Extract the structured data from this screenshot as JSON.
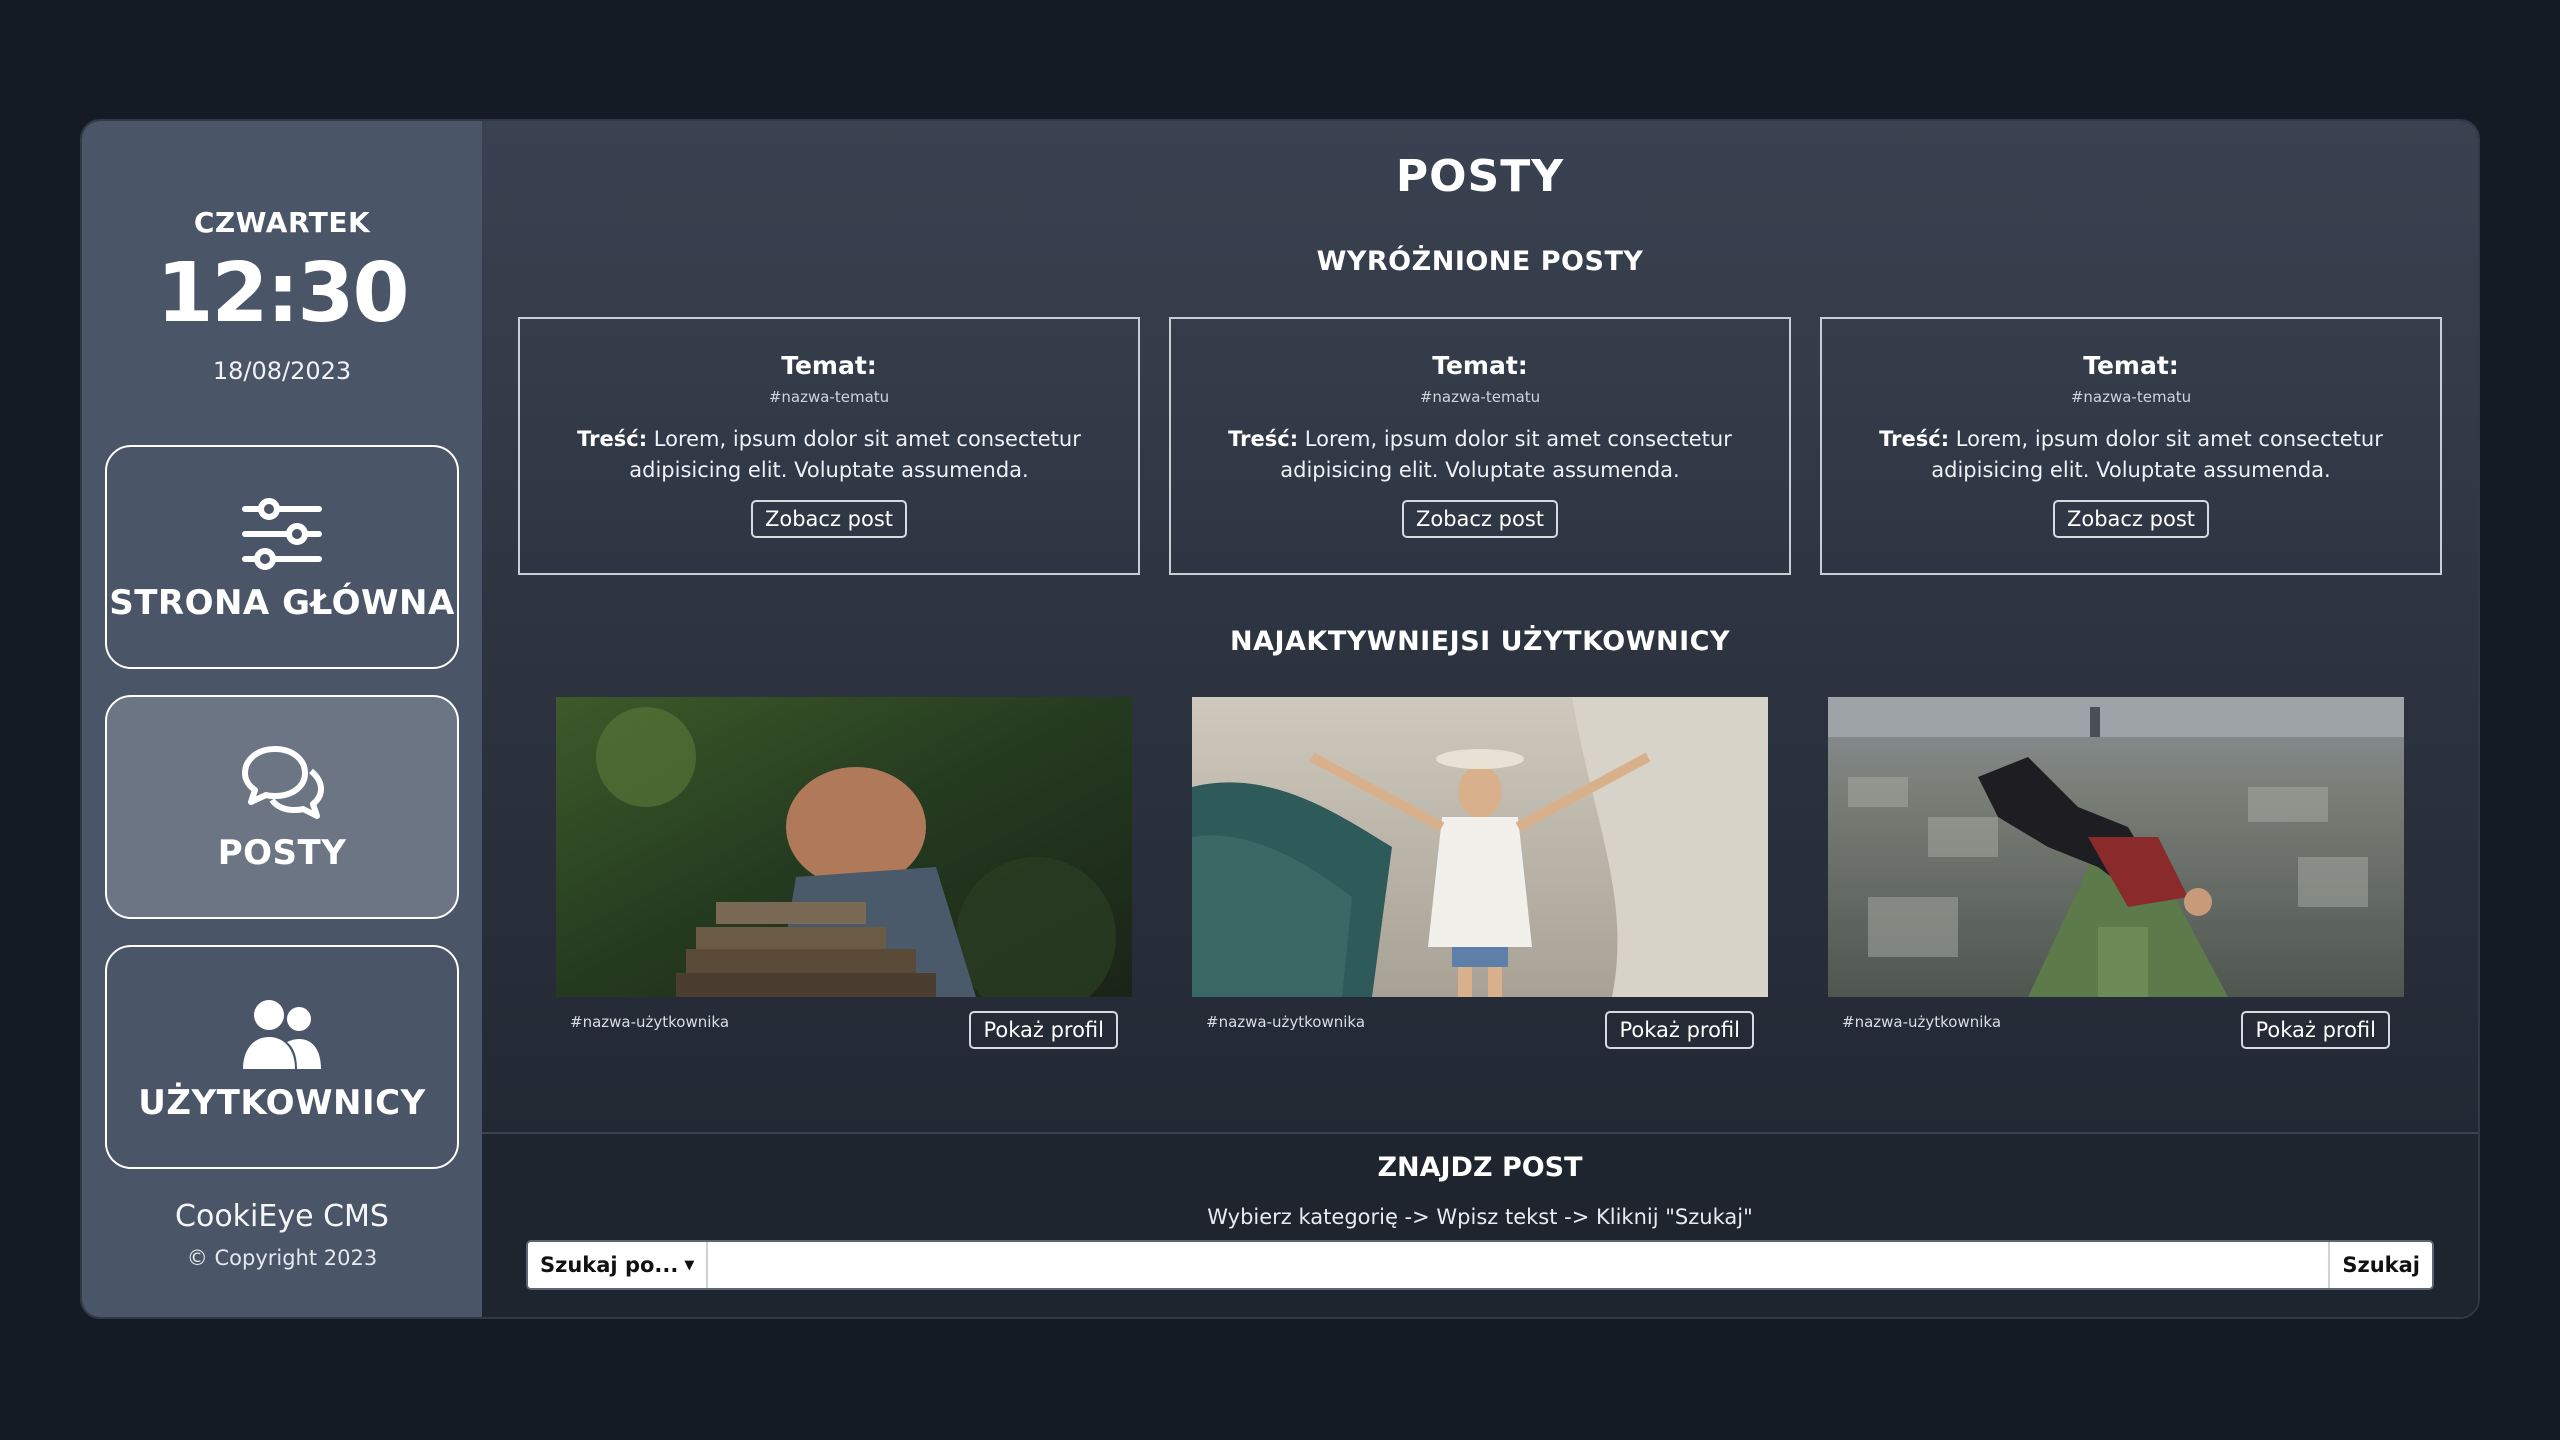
{
  "sidebar": {
    "day": "CZWARTEK",
    "time": "12:30",
    "date": "18/08/2023",
    "nav": [
      {
        "label": "STRONA GŁÓWNA",
        "icon": "sliders-icon"
      },
      {
        "label": "POSTY",
        "icon": "chat-bubbles-icon",
        "active": true
      },
      {
        "label": "UŻYTKOWNICY",
        "icon": "users-icon"
      }
    ],
    "brand": "CookiEye CMS",
    "copyright": "© Copyright 2023"
  },
  "main": {
    "title": "POSTY",
    "featured_title": "WYRÓŻNIONE POSTY",
    "posts": [
      {
        "topic_label": "Temat:",
        "tag": "#nazwa-tematu",
        "content_label": "Treść:",
        "content": "Lorem, ipsum dolor sit amet consectetur adipisicing elit. Voluptate assumenda.",
        "button": "Zobacz post"
      },
      {
        "topic_label": "Temat:",
        "tag": "#nazwa-tematu",
        "content_label": "Treść:",
        "content": "Lorem, ipsum dolor sit amet consectetur adipisicing elit. Voluptate assumenda.",
        "button": "Zobacz post"
      },
      {
        "topic_label": "Temat:",
        "tag": "#nazwa-tematu",
        "content_label": "Treść:",
        "content": "Lorem, ipsum dolor sit amet consectetur adipisicing elit. Voluptate assumenda.",
        "button": "Zobacz post"
      }
    ],
    "users_title": "NAJAKTYWNIEJSI UŻYTKOWNICY",
    "users": [
      {
        "username": "#nazwa-użytkownika",
        "button": "Pokaż profil"
      },
      {
        "username": "#nazwa-użytkownika",
        "button": "Pokaż profil"
      },
      {
        "username": "#nazwa-użytkownika",
        "button": "Pokaż profil"
      }
    ],
    "search": {
      "title": "ZNAJDZ POST",
      "hint": "Wybierz kategorię -> Wpisz tekst -> Kliknij \"Szukaj\"",
      "dropdown": "Szukaj po...",
      "input_value": "",
      "input_placeholder": "",
      "button": "Szukaj"
    }
  },
  "colors": {
    "page_bg": "#151b24",
    "sidebar_bg": "#4a5568",
    "active_nav_bg": "#6b7584"
  }
}
